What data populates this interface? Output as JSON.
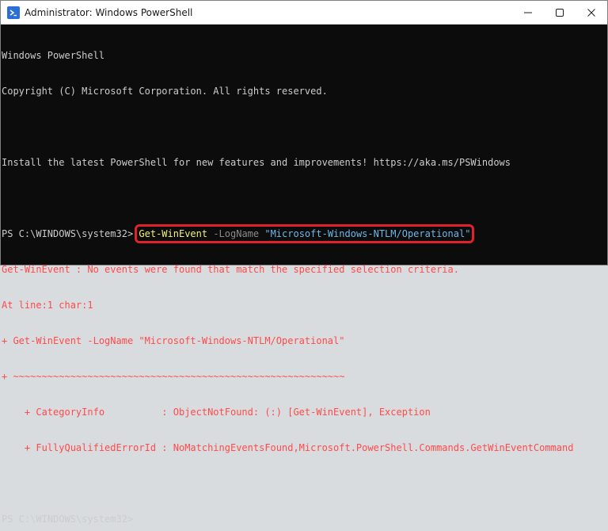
{
  "window": {
    "title": "Administrator: Windows PowerShell"
  },
  "terminal": {
    "line1": "Windows PowerShell",
    "line2": "Copyright (C) Microsoft Corporation. All rights reserved.",
    "line3": "",
    "line4": "Install the latest PowerShell for new features and improvements! https://aka.ms/PSWindows",
    "line5": "",
    "prompt1": "PS C:\\WINDOWS\\system32> ",
    "cmd_name": "Get-WinEvent",
    "cmd_param": " -LogName ",
    "cmd_arg": "\"Microsoft-Windows-NTLM/Operational\"",
    "err1": "Get-WinEvent : No events were found that match the specified selection criteria.",
    "err2": "At line:1 char:1",
    "err3": "+ Get-WinEvent -LogName \"Microsoft-Windows-NTLM/Operational\"",
    "err4": "+ ~~~~~~~~~~~~~~~~~~~~~~~~~~~~~~~~~~~~~~~~~~~~~~~~~~~~~~~~~~",
    "err5": "    + CategoryInfo          : ObjectNotFound: (:) [Get-WinEvent], Exception",
    "err6": "    + FullyQualifiedErrorId : NoMatchingEventsFound,Microsoft.PowerShell.Commands.GetWinEventCommand",
    "prompt2": "PS C:\\WINDOWS\\system32>"
  },
  "colors": {
    "terminal_bg": "#0c0c0c",
    "error_text": "#ff4a4a",
    "highlight_box": "#e0222c"
  }
}
